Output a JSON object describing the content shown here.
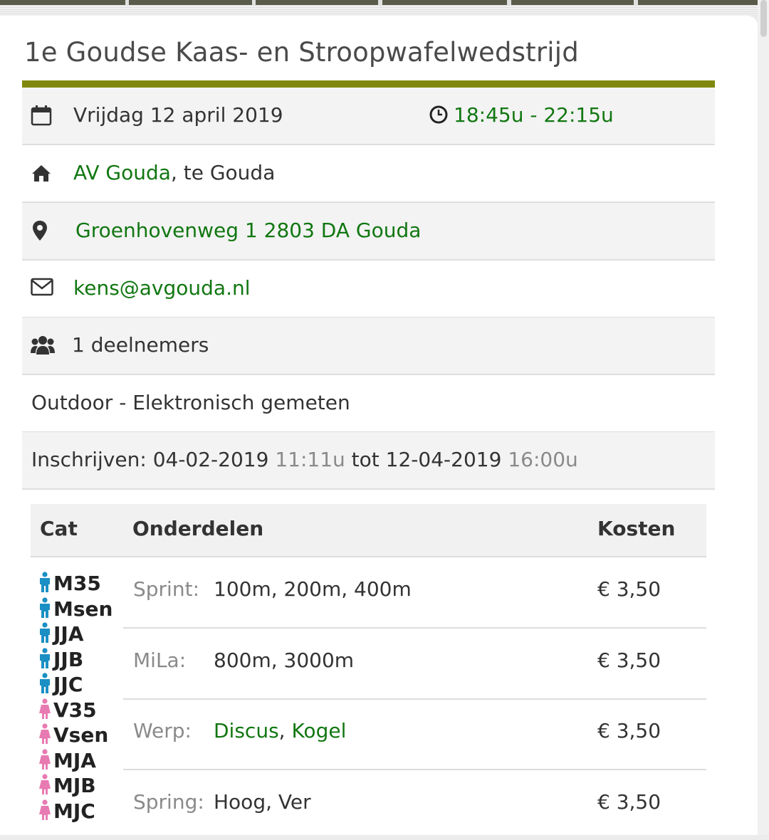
{
  "event": {
    "title": "1e Goudse Kaas- en Stroopwafelwedstrijd",
    "date": "Vrijdag 12 april 2019",
    "time": "18:45u - 22:15u",
    "club_link": "AV Gouda",
    "club_suffix": ", te Gouda",
    "address": "Groenhovenweg 1 2803 DA Gouda",
    "email": "kens@avgouda.nl",
    "participants": "1 deelnemers",
    "type": "Outdoor - Elektronisch gemeten",
    "registration": {
      "prefix": "Inschrijven: ",
      "start_date": "04-02-2019",
      "start_time": "11:11u",
      "between": "tot",
      "end_date": "12-04-2019",
      "end_time": "16:00u"
    }
  },
  "icons": {
    "date": "calendar-icon",
    "time": "clock-icon",
    "club": "home-icon",
    "address": "map-marker-icon",
    "email": "envelope-icon",
    "participants": "users-icon",
    "male": "male-person-icon",
    "female": "female-person-icon"
  },
  "colors": {
    "link": "#117711",
    "accent_rule": "#80890d",
    "male": "#1a8fc4",
    "female": "#e87ab2",
    "muted": "#8a8a8a"
  },
  "table": {
    "headers": {
      "cat": "Cat",
      "onderdelen": "Onderdelen",
      "kosten": "Kosten"
    },
    "categories": [
      {
        "label": "M35",
        "gender": "male"
      },
      {
        "label": "Msen",
        "gender": "male"
      },
      {
        "label": "JJA",
        "gender": "male"
      },
      {
        "label": "JJB",
        "gender": "male"
      },
      {
        "label": "JJC",
        "gender": "male"
      },
      {
        "label": "V35",
        "gender": "female"
      },
      {
        "label": "Vsen",
        "gender": "female"
      },
      {
        "label": "MJA",
        "gender": "female"
      },
      {
        "label": "MJB",
        "gender": "female"
      },
      {
        "label": "MJC",
        "gender": "female"
      }
    ],
    "rows": [
      {
        "group": "Sprint:",
        "events": "100m, 200m, 400m",
        "cost": "€ 3,50"
      },
      {
        "group": "MiLa:",
        "events": "800m, 3000m",
        "cost": "€ 3,50"
      },
      {
        "group": "Werp:",
        "event_links": [
          "Discus",
          "Kogel"
        ],
        "cost": "€ 3,50"
      },
      {
        "group": "Spring:",
        "events": "Hoog, Ver",
        "cost": "€ 3,50"
      }
    ]
  }
}
